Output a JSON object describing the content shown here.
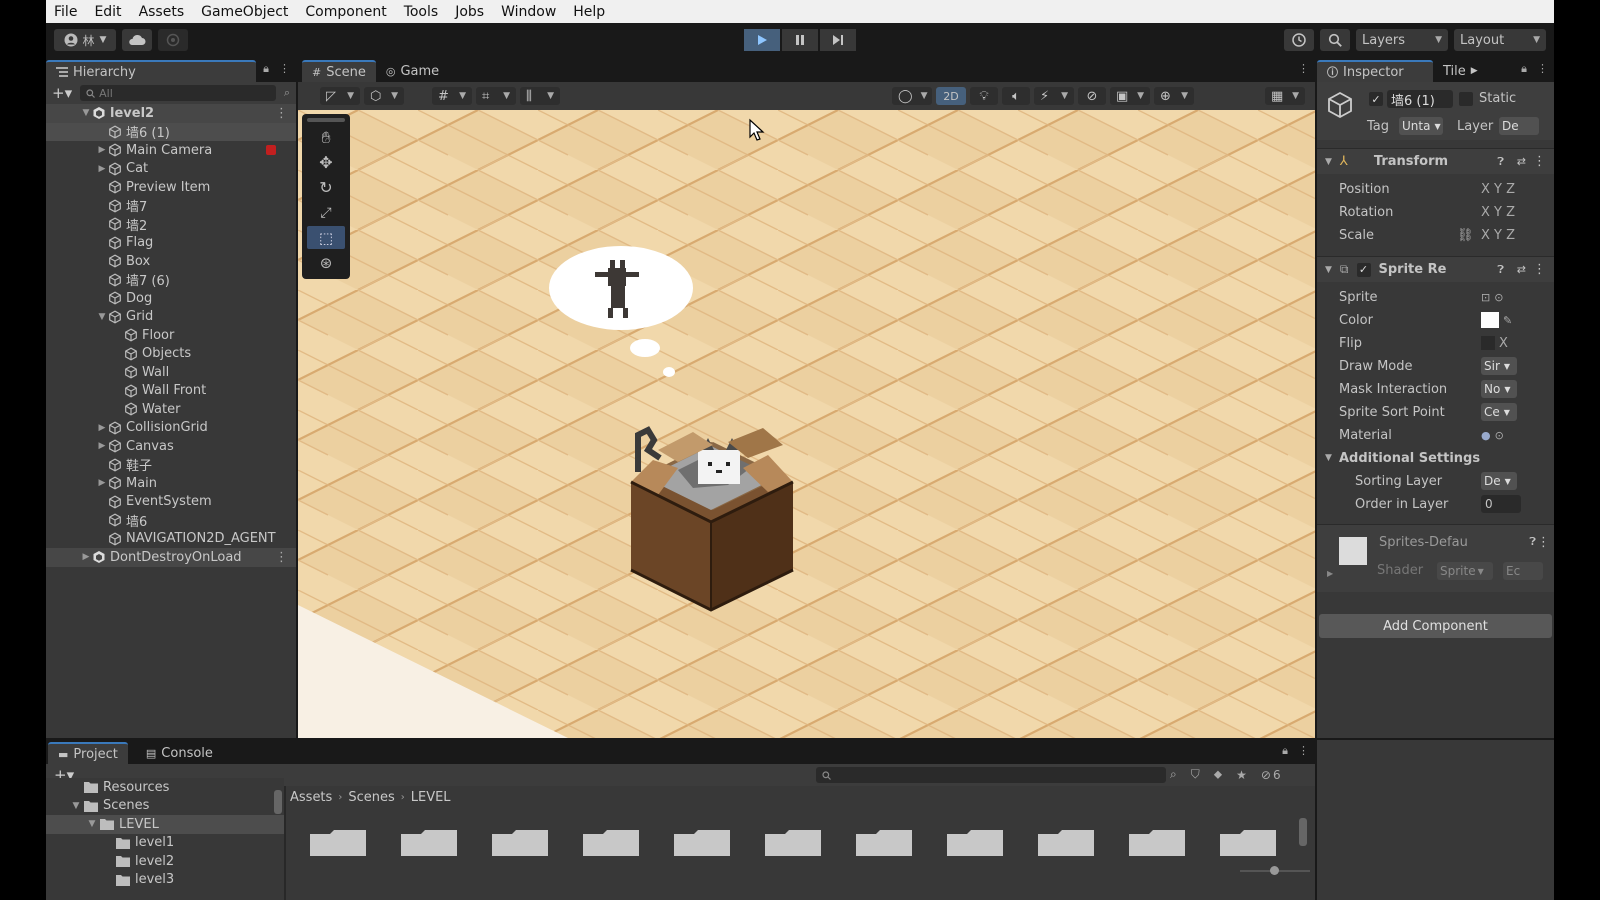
{
  "menu": [
    "File",
    "Edit",
    "Assets",
    "GameObject",
    "Component",
    "Tools",
    "Jobs",
    "Window",
    "Help"
  ],
  "toolbar": {
    "account_label": "林",
    "layers_label": "Layers",
    "layout_label": "Layout"
  },
  "hierarchy": {
    "tab_label": "Hierarchy",
    "search_placeholder": "All",
    "scene_name": "level2",
    "items": [
      {
        "label": "墙6 (1)",
        "indent": 1,
        "arrow": ""
      },
      {
        "label": "Main Camera",
        "indent": 1,
        "arrow": "▶"
      },
      {
        "label": "Cat",
        "indent": 1,
        "arrow": "▶"
      },
      {
        "label": "Preview Item",
        "indent": 1,
        "arrow": ""
      },
      {
        "label": "墙7",
        "indent": 1,
        "arrow": ""
      },
      {
        "label": "墙2",
        "indent": 1,
        "arrow": ""
      },
      {
        "label": "Flag",
        "indent": 1,
        "arrow": ""
      },
      {
        "label": "Box",
        "indent": 1,
        "arrow": ""
      },
      {
        "label": "墙7 (6)",
        "indent": 1,
        "arrow": ""
      },
      {
        "label": "Dog",
        "indent": 1,
        "arrow": ""
      },
      {
        "label": "Grid",
        "indent": 1,
        "arrow": "▼"
      },
      {
        "label": "Floor",
        "indent": 2,
        "arrow": ""
      },
      {
        "label": "Objects",
        "indent": 2,
        "arrow": ""
      },
      {
        "label": "Wall",
        "indent": 2,
        "arrow": ""
      },
      {
        "label": "Wall Front",
        "indent": 2,
        "arrow": ""
      },
      {
        "label": "Water",
        "indent": 2,
        "arrow": ""
      },
      {
        "label": "CollisionGrid",
        "indent": 1,
        "arrow": "▶"
      },
      {
        "label": "Canvas",
        "indent": 1,
        "arrow": "▶"
      },
      {
        "label": "鞋子",
        "indent": 1,
        "arrow": ""
      },
      {
        "label": "Main",
        "indent": 1,
        "arrow": "▶"
      },
      {
        "label": "EventSystem",
        "indent": 1,
        "arrow": ""
      },
      {
        "label": "墙6",
        "indent": 1,
        "arrow": ""
      },
      {
        "label": "NAVIGATION2D_AGENT",
        "indent": 1,
        "arrow": ""
      }
    ],
    "dont_destroy": "DontDestroyOnLoad"
  },
  "scene": {
    "tab_scene": "Scene",
    "tab_game": "Game",
    "mode_2d": "2D"
  },
  "inspector": {
    "tab_label": "Inspector",
    "tab_tile": "Tile",
    "object_name": "墙6 (1)",
    "static_label": "Static",
    "tag_label": "Tag",
    "tag_value": "Unta",
    "layer_label": "Layer",
    "layer_value": "De",
    "transform": {
      "title": "Transform",
      "position": "Position",
      "rotation": "Rotation",
      "scale": "Scale"
    },
    "xyz": "X Y Z",
    "sprite_renderer": {
      "title": "Sprite Re",
      "sprite": "Sprite",
      "color": "Color",
      "flip": "Flip",
      "flip_x": "X",
      "draw_mode": "Draw Mode",
      "draw_mode_value": "Sir",
      "mask_interaction": "Mask Interaction",
      "mask_value": "No",
      "sort_point": "Sprite Sort Point",
      "sort_point_value": "Ce",
      "material": "Material",
      "additional": "Additional Settings",
      "sorting_layer": "Sorting Layer",
      "sorting_layer_value": "De",
      "order_in_layer": "Order in Layer",
      "order_value": "0"
    },
    "material_name": "Sprites-Defau",
    "shader_label": "Shader",
    "shader_value": "Sprite",
    "shader_edit": "Ec",
    "add_component": "Add Component"
  },
  "project": {
    "tab_project": "Project",
    "tab_console": "Console",
    "hidden_count": "6",
    "tree": [
      {
        "label": "Resources",
        "indent": 1,
        "arrow": ""
      },
      {
        "label": "Scenes",
        "indent": 1,
        "arrow": "▼"
      },
      {
        "label": "LEVEL",
        "indent": 2,
        "arrow": "▼"
      },
      {
        "label": "level1",
        "indent": 3,
        "arrow": ""
      },
      {
        "label": "level2",
        "indent": 3,
        "arrow": ""
      },
      {
        "label": "level3",
        "indent": 3,
        "arrow": ""
      }
    ],
    "breadcrumb": [
      "Assets",
      "Scenes",
      "LEVEL"
    ]
  },
  "colors": {
    "floor_light": "#f3dcb3",
    "floor_mid": "#e8c48e",
    "floor_line": "#d9a96c",
    "accent": "#3a79bb",
    "play_active": "#46607c"
  }
}
